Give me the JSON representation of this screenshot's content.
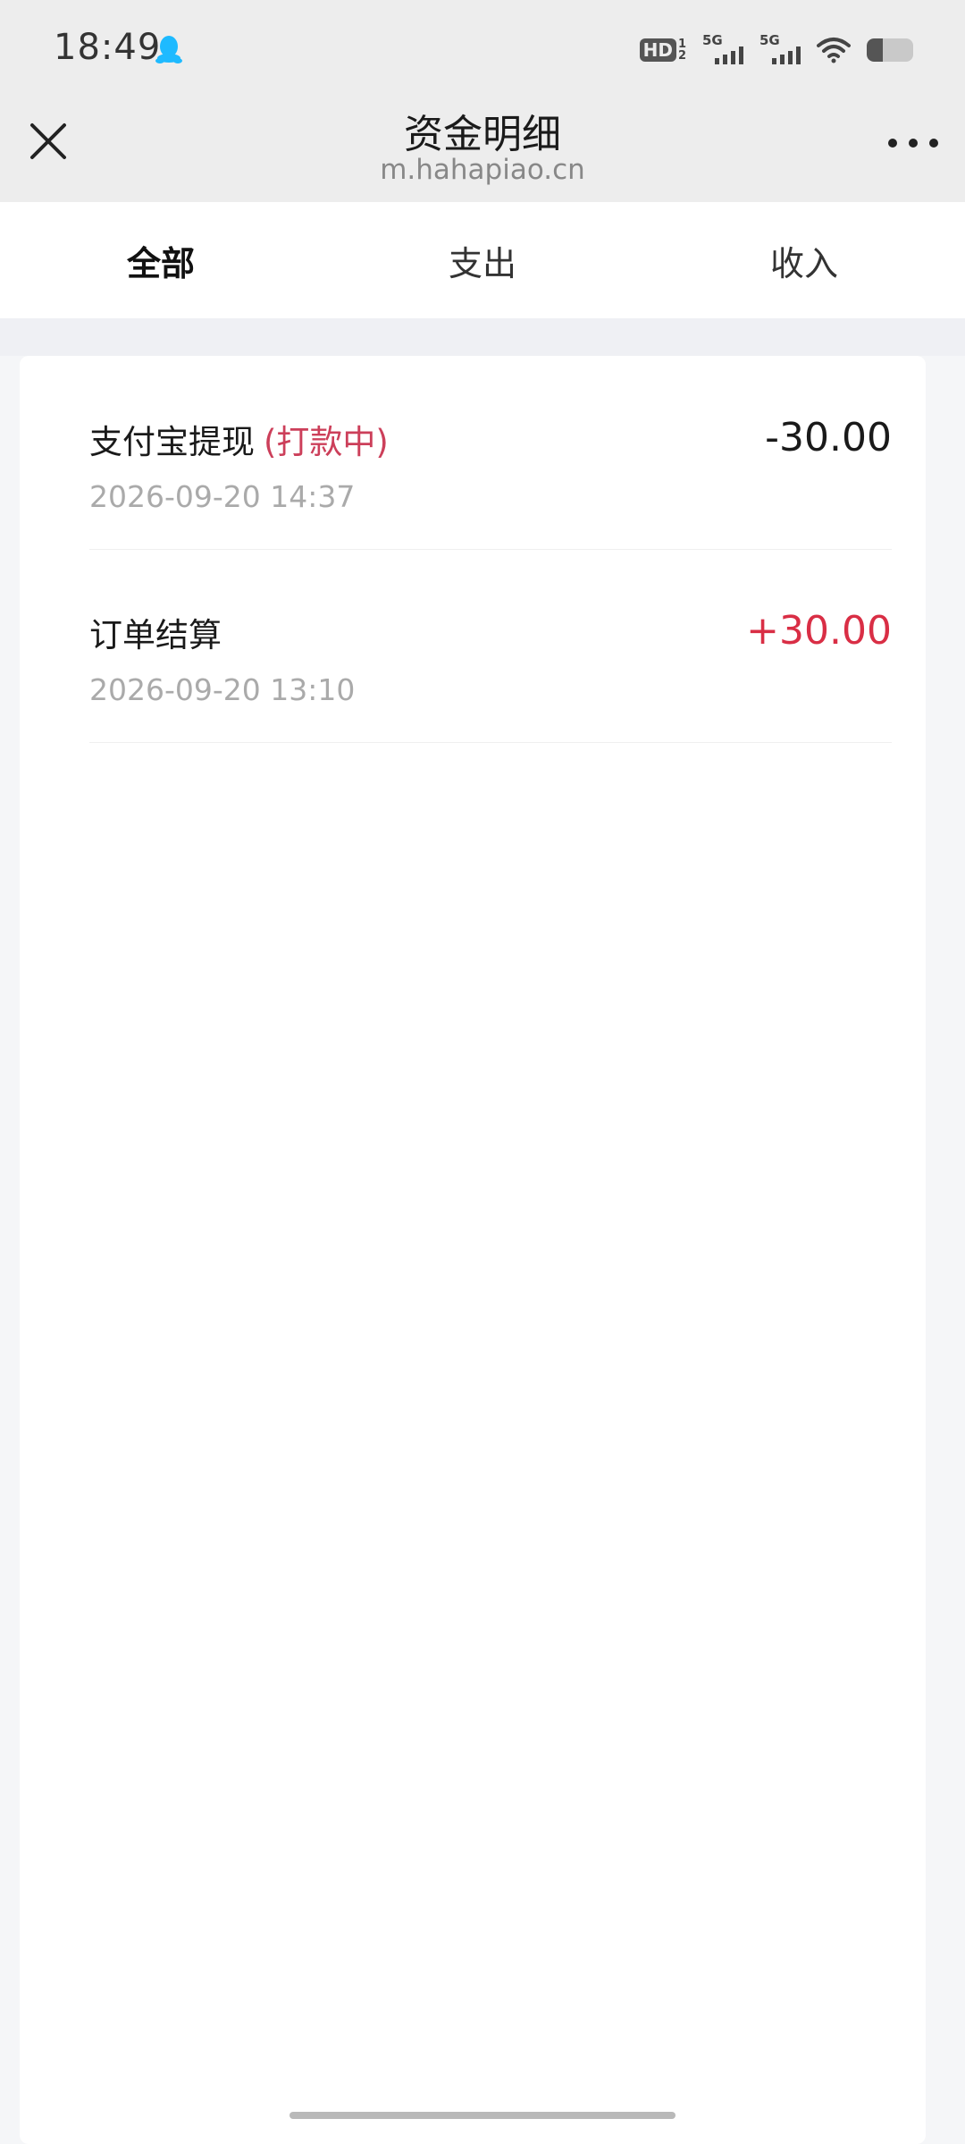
{
  "status_bar": {
    "time": "18:49",
    "hd_label": "HD",
    "hd_sim": "1",
    "hd_sim2": "2",
    "signal1_label": "5G",
    "signal2_label": "5G",
    "battery_level": 0.35
  },
  "header": {
    "title": "资金明细",
    "url": "m.hahapiao.cn"
  },
  "tabs": [
    {
      "label": "全部",
      "active": true
    },
    {
      "label": "支出",
      "active": false
    },
    {
      "label": "收入",
      "active": false
    }
  ],
  "records": [
    {
      "title": "支付宝提现",
      "status": "(打款中)",
      "time": "2026-09-20 14:37",
      "amount": "-30.00"
    },
    {
      "title": "订单结算",
      "status": "",
      "time": "2026-09-20 13:10",
      "amount": "+30.00"
    }
  ],
  "colors": {
    "income": "#d92e45",
    "status_pending": "#cc3f5a",
    "qq_icon": "#1ebaff"
  }
}
